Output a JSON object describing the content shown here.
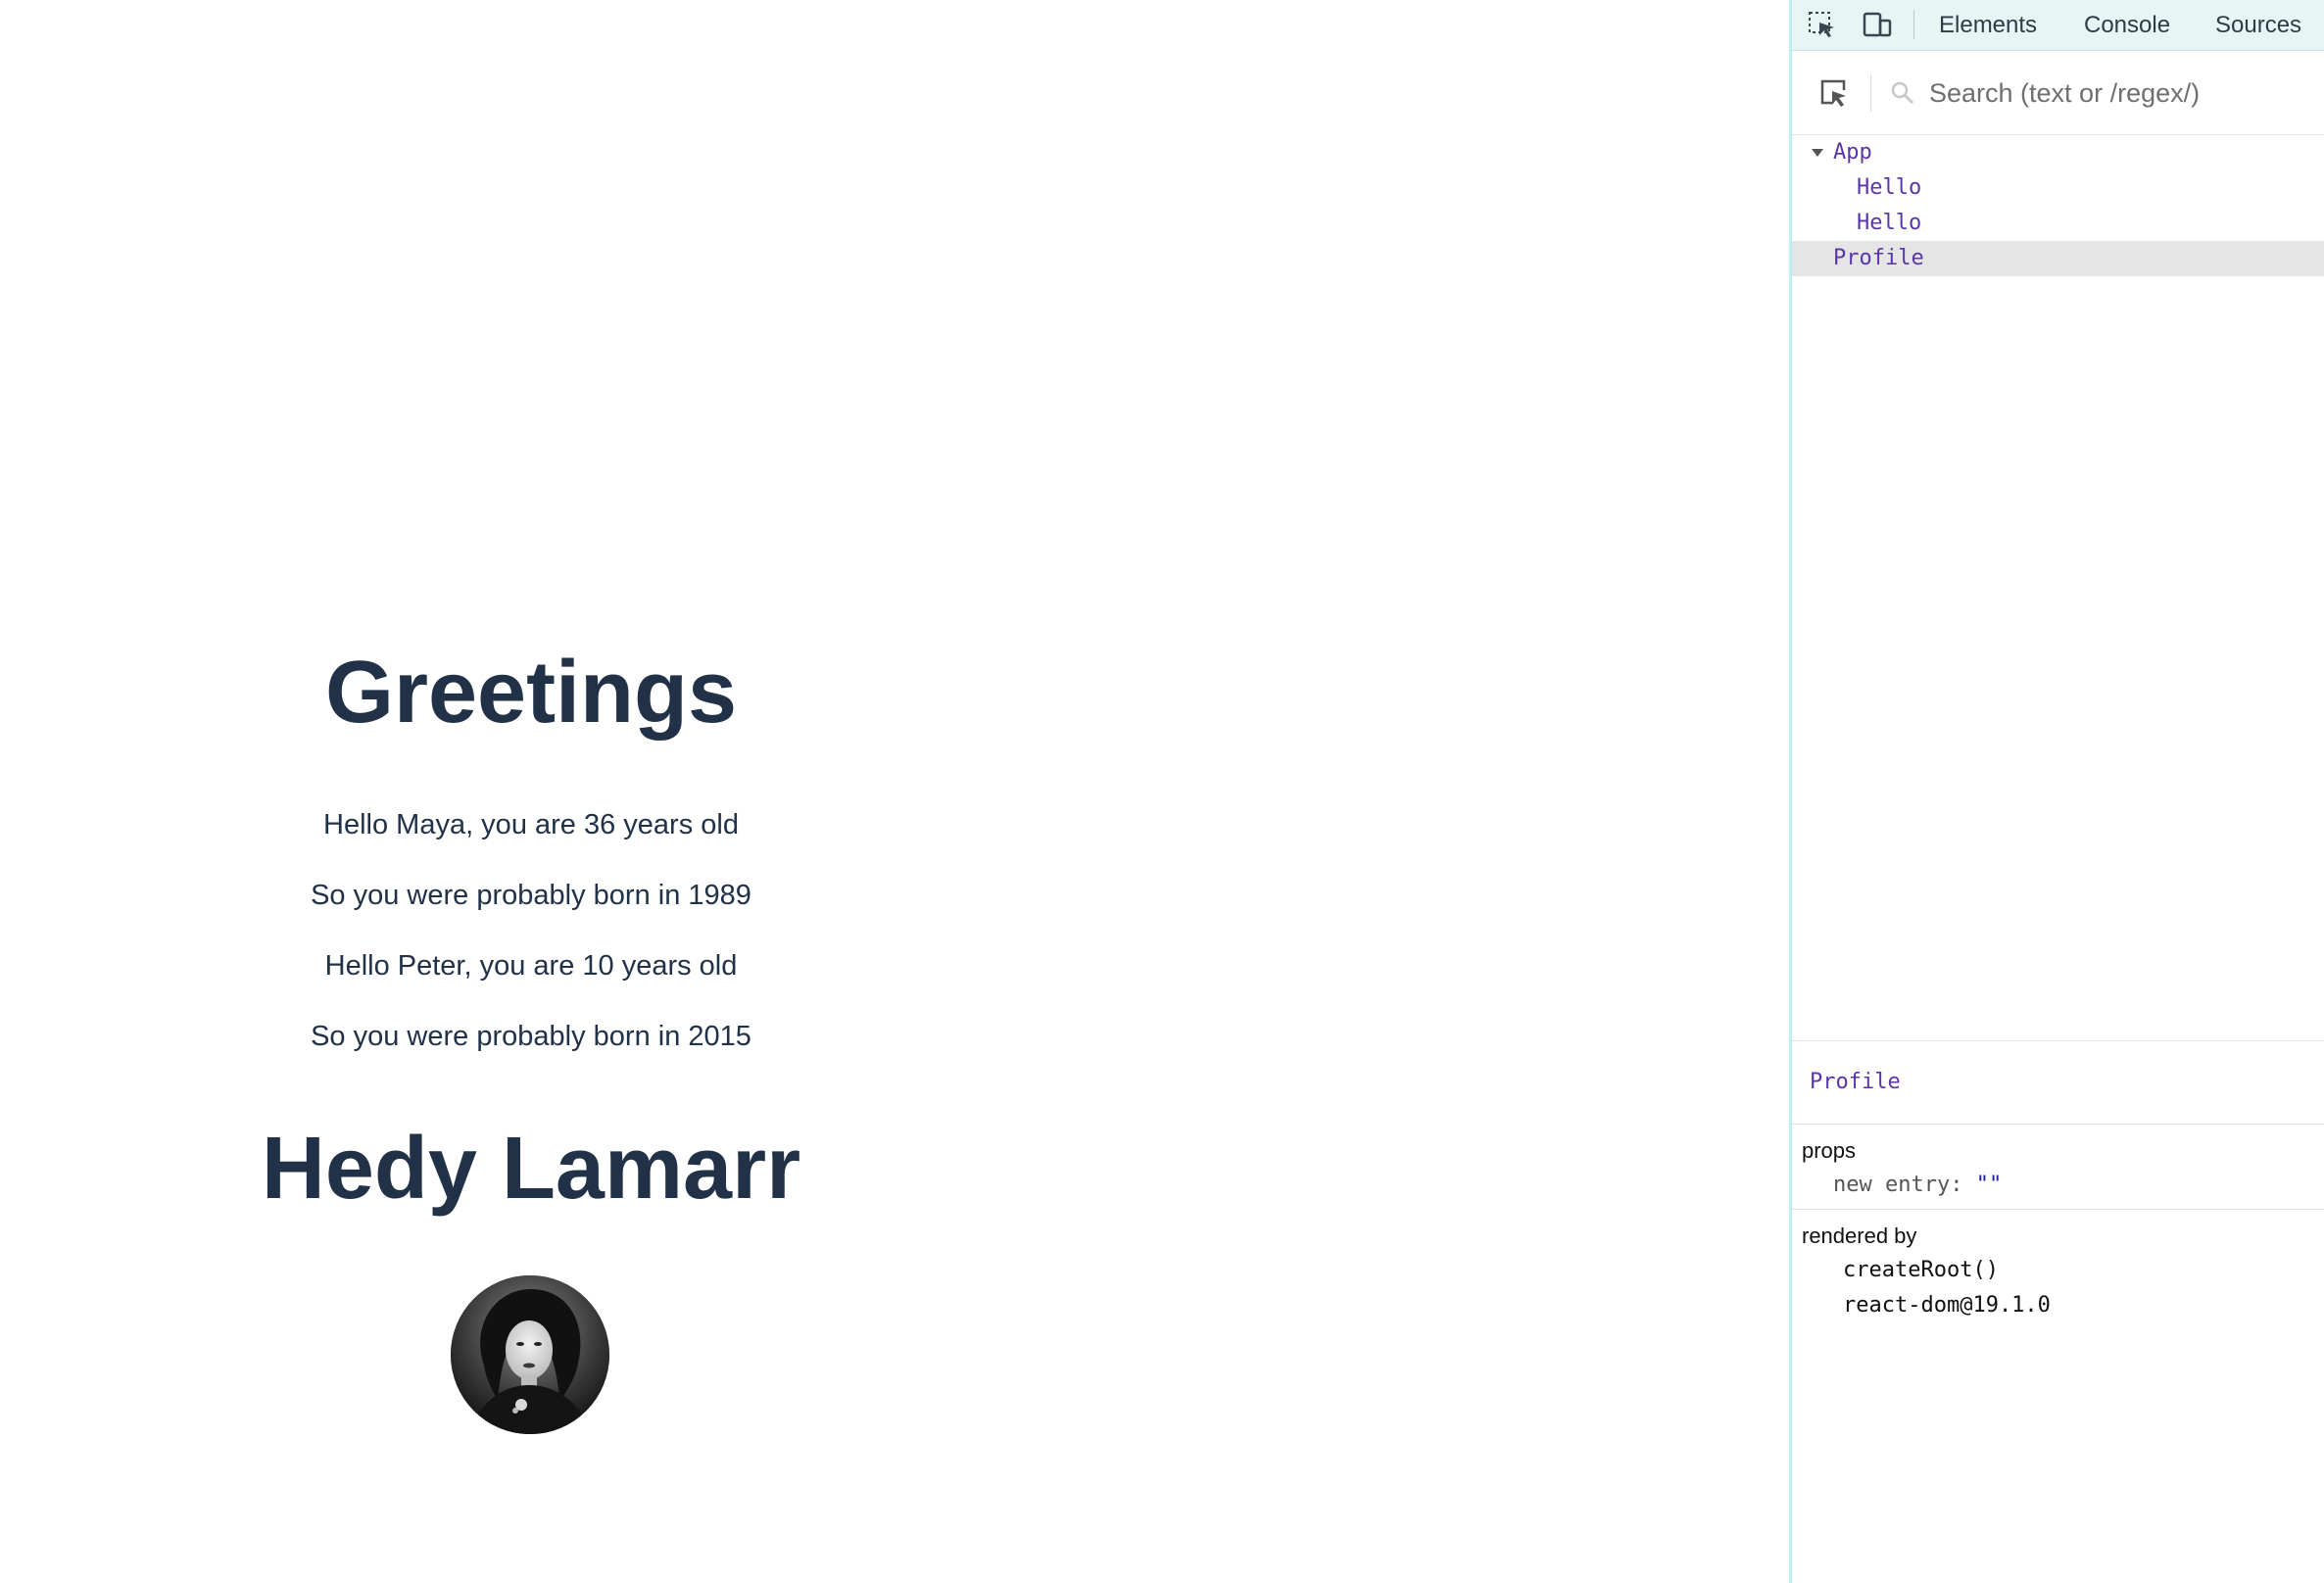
{
  "app": {
    "heading": "Greetings",
    "lines": [
      "Hello Maya, you are 36 years old",
      "So you were probably born in 1989",
      "Hello Peter, you are 10 years old",
      "So you were probably born in 2015"
    ],
    "profile_name": "Hedy Lamarr"
  },
  "devtools": {
    "tabs": [
      "Elements",
      "Console",
      "Sources"
    ],
    "search_placeholder": "Search (text or /regex/)",
    "tree": [
      {
        "label": "App",
        "expanded": true
      },
      {
        "label": "Hello"
      },
      {
        "label": "Hello"
      },
      {
        "label": "Profile",
        "selected": true
      }
    ],
    "inspector": {
      "component": "Profile",
      "props_title": "props",
      "props": [
        {
          "key": "new entry",
          "value": "\"\""
        }
      ],
      "rendered_by_title": "rendered by",
      "rendered_by": [
        "createRoot()",
        "react-dom@19.1.0"
      ]
    }
  },
  "colors": {
    "heading": "#213248",
    "tabbar_bg": "#e7f5f4",
    "component_name": "#5b36a8",
    "selected_row_bg": "#e5e5e5"
  }
}
